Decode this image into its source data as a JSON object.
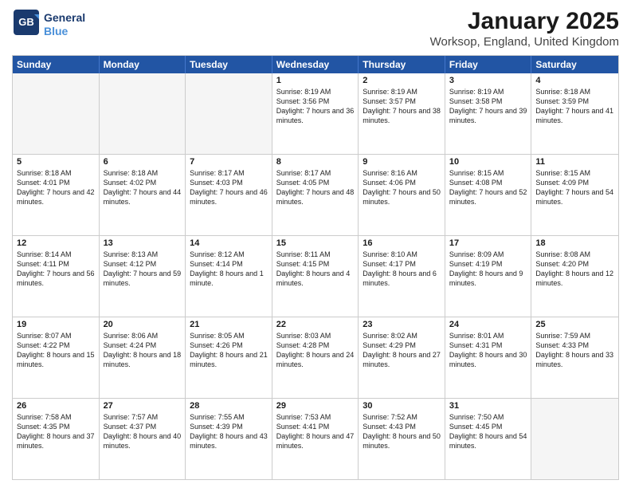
{
  "logo": {
    "line1": "General",
    "line2": "Blue"
  },
  "title": "January 2025",
  "subtitle": "Worksop, England, United Kingdom",
  "days": [
    "Sunday",
    "Monday",
    "Tuesday",
    "Wednesday",
    "Thursday",
    "Friday",
    "Saturday"
  ],
  "weeks": [
    [
      {
        "day": "",
        "sunrise": "",
        "sunset": "",
        "daylight": "",
        "empty": true
      },
      {
        "day": "",
        "sunrise": "",
        "sunset": "",
        "daylight": "",
        "empty": true
      },
      {
        "day": "",
        "sunrise": "",
        "sunset": "",
        "daylight": "",
        "empty": true
      },
      {
        "day": "1",
        "sunrise": "Sunrise: 8:19 AM",
        "sunset": "Sunset: 3:56 PM",
        "daylight": "Daylight: 7 hours and 36 minutes."
      },
      {
        "day": "2",
        "sunrise": "Sunrise: 8:19 AM",
        "sunset": "Sunset: 3:57 PM",
        "daylight": "Daylight: 7 hours and 38 minutes."
      },
      {
        "day": "3",
        "sunrise": "Sunrise: 8:19 AM",
        "sunset": "Sunset: 3:58 PM",
        "daylight": "Daylight: 7 hours and 39 minutes."
      },
      {
        "day": "4",
        "sunrise": "Sunrise: 8:18 AM",
        "sunset": "Sunset: 3:59 PM",
        "daylight": "Daylight: 7 hours and 41 minutes."
      }
    ],
    [
      {
        "day": "5",
        "sunrise": "Sunrise: 8:18 AM",
        "sunset": "Sunset: 4:01 PM",
        "daylight": "Daylight: 7 hours and 42 minutes."
      },
      {
        "day": "6",
        "sunrise": "Sunrise: 8:18 AM",
        "sunset": "Sunset: 4:02 PM",
        "daylight": "Daylight: 7 hours and 44 minutes."
      },
      {
        "day": "7",
        "sunrise": "Sunrise: 8:17 AM",
        "sunset": "Sunset: 4:03 PM",
        "daylight": "Daylight: 7 hours and 46 minutes."
      },
      {
        "day": "8",
        "sunrise": "Sunrise: 8:17 AM",
        "sunset": "Sunset: 4:05 PM",
        "daylight": "Daylight: 7 hours and 48 minutes."
      },
      {
        "day": "9",
        "sunrise": "Sunrise: 8:16 AM",
        "sunset": "Sunset: 4:06 PM",
        "daylight": "Daylight: 7 hours and 50 minutes."
      },
      {
        "day": "10",
        "sunrise": "Sunrise: 8:15 AM",
        "sunset": "Sunset: 4:08 PM",
        "daylight": "Daylight: 7 hours and 52 minutes."
      },
      {
        "day": "11",
        "sunrise": "Sunrise: 8:15 AM",
        "sunset": "Sunset: 4:09 PM",
        "daylight": "Daylight: 7 hours and 54 minutes."
      }
    ],
    [
      {
        "day": "12",
        "sunrise": "Sunrise: 8:14 AM",
        "sunset": "Sunset: 4:11 PM",
        "daylight": "Daylight: 7 hours and 56 minutes."
      },
      {
        "day": "13",
        "sunrise": "Sunrise: 8:13 AM",
        "sunset": "Sunset: 4:12 PM",
        "daylight": "Daylight: 7 hours and 59 minutes."
      },
      {
        "day": "14",
        "sunrise": "Sunrise: 8:12 AM",
        "sunset": "Sunset: 4:14 PM",
        "daylight": "Daylight: 8 hours and 1 minute."
      },
      {
        "day": "15",
        "sunrise": "Sunrise: 8:11 AM",
        "sunset": "Sunset: 4:15 PM",
        "daylight": "Daylight: 8 hours and 4 minutes."
      },
      {
        "day": "16",
        "sunrise": "Sunrise: 8:10 AM",
        "sunset": "Sunset: 4:17 PM",
        "daylight": "Daylight: 8 hours and 6 minutes."
      },
      {
        "day": "17",
        "sunrise": "Sunrise: 8:09 AM",
        "sunset": "Sunset: 4:19 PM",
        "daylight": "Daylight: 8 hours and 9 minutes."
      },
      {
        "day": "18",
        "sunrise": "Sunrise: 8:08 AM",
        "sunset": "Sunset: 4:20 PM",
        "daylight": "Daylight: 8 hours and 12 minutes."
      }
    ],
    [
      {
        "day": "19",
        "sunrise": "Sunrise: 8:07 AM",
        "sunset": "Sunset: 4:22 PM",
        "daylight": "Daylight: 8 hours and 15 minutes."
      },
      {
        "day": "20",
        "sunrise": "Sunrise: 8:06 AM",
        "sunset": "Sunset: 4:24 PM",
        "daylight": "Daylight: 8 hours and 18 minutes."
      },
      {
        "day": "21",
        "sunrise": "Sunrise: 8:05 AM",
        "sunset": "Sunset: 4:26 PM",
        "daylight": "Daylight: 8 hours and 21 minutes."
      },
      {
        "day": "22",
        "sunrise": "Sunrise: 8:03 AM",
        "sunset": "Sunset: 4:28 PM",
        "daylight": "Daylight: 8 hours and 24 minutes."
      },
      {
        "day": "23",
        "sunrise": "Sunrise: 8:02 AM",
        "sunset": "Sunset: 4:29 PM",
        "daylight": "Daylight: 8 hours and 27 minutes."
      },
      {
        "day": "24",
        "sunrise": "Sunrise: 8:01 AM",
        "sunset": "Sunset: 4:31 PM",
        "daylight": "Daylight: 8 hours and 30 minutes."
      },
      {
        "day": "25",
        "sunrise": "Sunrise: 7:59 AM",
        "sunset": "Sunset: 4:33 PM",
        "daylight": "Daylight: 8 hours and 33 minutes."
      }
    ],
    [
      {
        "day": "26",
        "sunrise": "Sunrise: 7:58 AM",
        "sunset": "Sunset: 4:35 PM",
        "daylight": "Daylight: 8 hours and 37 minutes."
      },
      {
        "day": "27",
        "sunrise": "Sunrise: 7:57 AM",
        "sunset": "Sunset: 4:37 PM",
        "daylight": "Daylight: 8 hours and 40 minutes."
      },
      {
        "day": "28",
        "sunrise": "Sunrise: 7:55 AM",
        "sunset": "Sunset: 4:39 PM",
        "daylight": "Daylight: 8 hours and 43 minutes."
      },
      {
        "day": "29",
        "sunrise": "Sunrise: 7:53 AM",
        "sunset": "Sunset: 4:41 PM",
        "daylight": "Daylight: 8 hours and 47 minutes."
      },
      {
        "day": "30",
        "sunrise": "Sunrise: 7:52 AM",
        "sunset": "Sunset: 4:43 PM",
        "daylight": "Daylight: 8 hours and 50 minutes."
      },
      {
        "day": "31",
        "sunrise": "Sunrise: 7:50 AM",
        "sunset": "Sunset: 4:45 PM",
        "daylight": "Daylight: 8 hours and 54 minutes."
      },
      {
        "day": "",
        "sunrise": "",
        "sunset": "",
        "daylight": "",
        "empty": true
      }
    ]
  ]
}
